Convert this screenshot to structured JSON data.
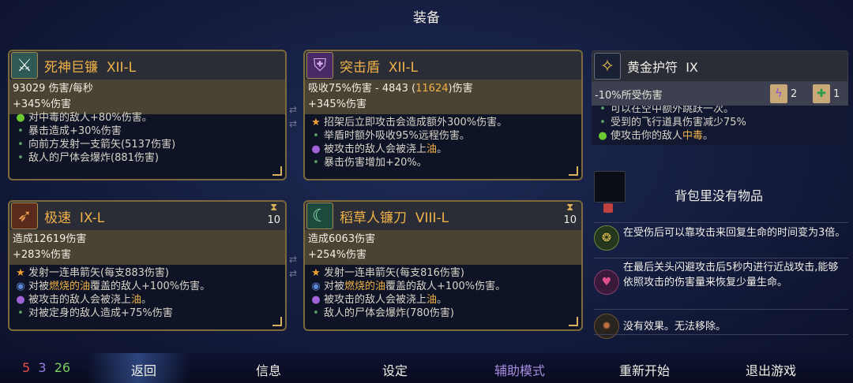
{
  "screen_title": "装备",
  "cards": [
    {
      "name": "死神巨镰",
      "tier": "XII-L",
      "icon": "scythe-icon",
      "stats": [
        {
          "text": "93029 伤害/每秒"
        },
        {
          "text": "+345%伤害"
        }
      ],
      "effects": [
        {
          "bullet": "green",
          "text": "对中毒的敌人+80%伤害。"
        },
        {
          "bullet": "dot",
          "text": "暴击造成+30%伤害"
        },
        {
          "bullet": "dot",
          "text": "向前方发射一支箭矢(5137伤害)"
        },
        {
          "bullet": "dot",
          "text": "敌人的尸体会爆炸(881伤害)"
        }
      ]
    },
    {
      "name": "突击盾",
      "tier": "XII-L",
      "icon": "shield-icon",
      "stats_line1_pre": "吸收75%伤害 - 4843 (",
      "stats_line1_gold": "11624",
      "stats_line1_post": ")伤害",
      "stats_line2": "+345%伤害",
      "effects": [
        {
          "bullet": "star",
          "text": "招架后立即攻击会造成额外300%伤害。"
        },
        {
          "bullet": "dot",
          "text": "举盾时额外吸收95%远程伤害。"
        },
        {
          "bullet": "purple",
          "text": "被攻击的敌人会被浇上",
          "oil": "油",
          "post": "。"
        },
        {
          "bullet": "dot",
          "text": "暴击伤害增加+20%。"
        }
      ]
    },
    {
      "name": "极速",
      "tier": "IX-L",
      "icon": "speed-icon",
      "timer": "10",
      "stats": [
        {
          "text": "造成12619伤害"
        },
        {
          "text": "+283%伤害"
        }
      ],
      "effects": [
        {
          "bullet": "star",
          "text": "发射一连串箭矢(每支883伤害)"
        },
        {
          "bullet": "blue",
          "pre": "对被",
          "oil": "燃烧的油",
          "text": "覆盖的敌人+100%伤害。"
        },
        {
          "bullet": "purple",
          "text": "被攻击的敌人会被浇上",
          "oil": "油",
          "post": "。"
        },
        {
          "bullet": "dot",
          "text": "对被定身的敌人造成+75%伤害"
        }
      ]
    },
    {
      "name": "稻草人镰刀",
      "tier": "VIII-L",
      "icon": "sickle-icon",
      "timer": "10",
      "stats": [
        {
          "text": "造成6063伤害"
        },
        {
          "text": "+254%伤害"
        }
      ],
      "effects": [
        {
          "bullet": "star",
          "text": "发射一连串箭矢(每支816伤害)"
        },
        {
          "bullet": "blue",
          "pre": "对被",
          "oil": "燃烧的油",
          "text": "覆盖的敌人+100%伤害。"
        },
        {
          "bullet": "purple",
          "text": "被攻击的敌人会被浇上",
          "oil": "油",
          "post": "。"
        },
        {
          "bullet": "dot",
          "text": "敌人的尸体会爆炸(780伤害)"
        }
      ]
    }
  ],
  "amulet": {
    "name": "黄金护符",
    "tier": "IX",
    "icon": "amulet-icon",
    "stat": "-10%所受伤害",
    "scroll1_count": "2",
    "scroll2_count": "1",
    "effects": [
      {
        "bullet": "dot",
        "text": "可以在空中额外跳跃一次。"
      },
      {
        "bullet": "dot",
        "text": "受到的飞行道具伤害减少75%"
      },
      {
        "bullet": "green",
        "pre": "使攻击你的敌人",
        "poison": "中毒",
        "post": "。"
      }
    ]
  },
  "bag": {
    "empty_text": "背包里没有物品"
  },
  "passives": [
    {
      "icon": "regen-icon",
      "text": "在受伤后可以靠攻击来回复生命的时间变为3倍。"
    },
    {
      "icon": "melee-heal-icon",
      "text": "在最后关头闪避攻击后5秒内进行近战攻击,能够依照攻击的伤害量来恢复少量生命。"
    },
    {
      "icon": "curse-icon",
      "text": "没有效果。无法移除。"
    }
  ],
  "bottom": {
    "count_red": "5",
    "count_purple": "3",
    "count_green": "26",
    "back": "返回",
    "info": "信息",
    "settings": "设定",
    "assist": "辅助模式",
    "restart": "重新开始",
    "quit": "退出游戏"
  },
  "colors": {
    "gold": "#f0b246",
    "red": "#e0504a",
    "purple": "#9a7ee0",
    "green": "#7ccd5e"
  }
}
